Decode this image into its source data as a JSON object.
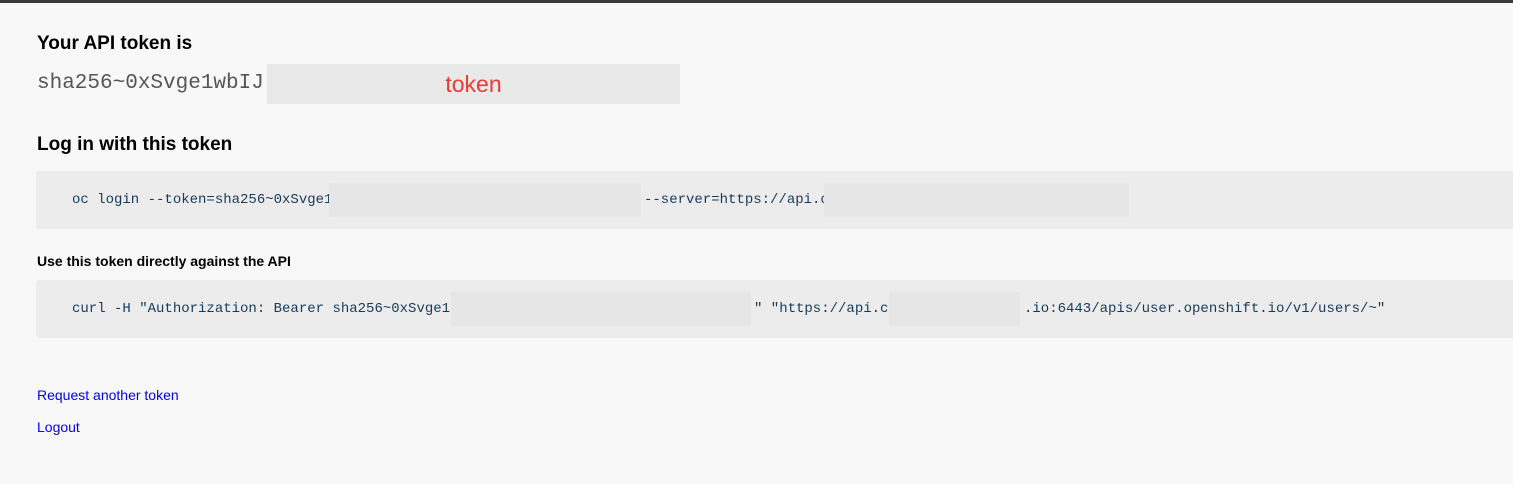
{
  "token_section": {
    "heading": "Your API token is",
    "token_value": "sha256~0xSvge1wbIJ",
    "redaction_label": "token"
  },
  "login_section": {
    "heading": "Log in with this token",
    "command_part1": "oc login --token=sha256~0xSvge1",
    "command_part2": "--server=https://api.c"
  },
  "api_section": {
    "heading": "Use this token directly against the API",
    "command_part1": "curl -H \"Authorization: Bearer sha256~0xSvge1",
    "command_part2": "\" \"https://api.c",
    "command_part3": ".io:6443/apis/user.openshift.io/v1/users/~\""
  },
  "links": {
    "request_another": "Request another token",
    "logout": "Logout"
  },
  "colors": {
    "background": "#f8f8f8",
    "code_background": "#ececec",
    "code_text": "#163b5a",
    "link": "#0000ee",
    "redaction_label": "#ef3a33"
  }
}
